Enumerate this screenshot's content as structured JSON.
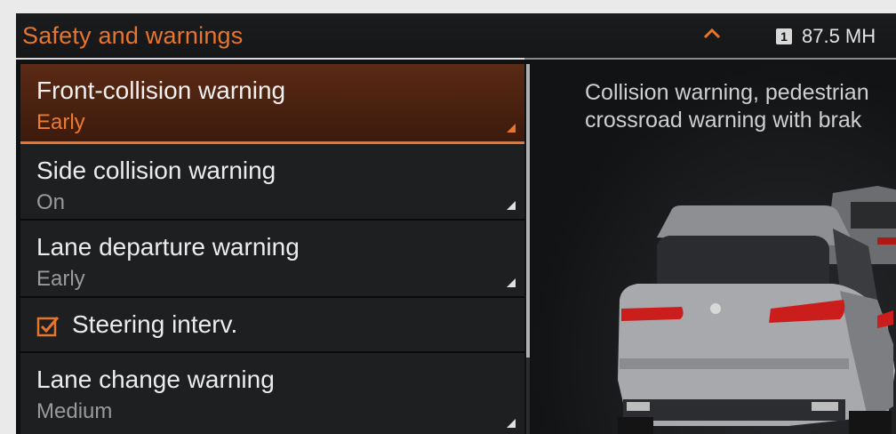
{
  "header": {
    "title": "Safety and warnings",
    "station_preset": "1",
    "station_frequency": "87.5 MH"
  },
  "menu": {
    "items": [
      {
        "label": "Front-collision warning",
        "value": "Early",
        "selected": true
      },
      {
        "label": "Side collision warning",
        "value": "On"
      },
      {
        "label": "Lane departure warning",
        "value": "Early"
      },
      {
        "label": "Steering interv.",
        "checked": true
      },
      {
        "label": "Lane change warning",
        "value": "Medium"
      }
    ]
  },
  "info": {
    "line1": "Collision warning, pedestrian",
    "line2": "crossroad warning with brak"
  },
  "colors": {
    "accent": "#e8752a",
    "background": "#101112",
    "item_background": "#1e1f21"
  },
  "icons": {
    "header_chevron": "chevron-up-icon",
    "submenu_indicator": "corner-triangle-icon",
    "checkbox": "checkbox-checked-icon"
  }
}
